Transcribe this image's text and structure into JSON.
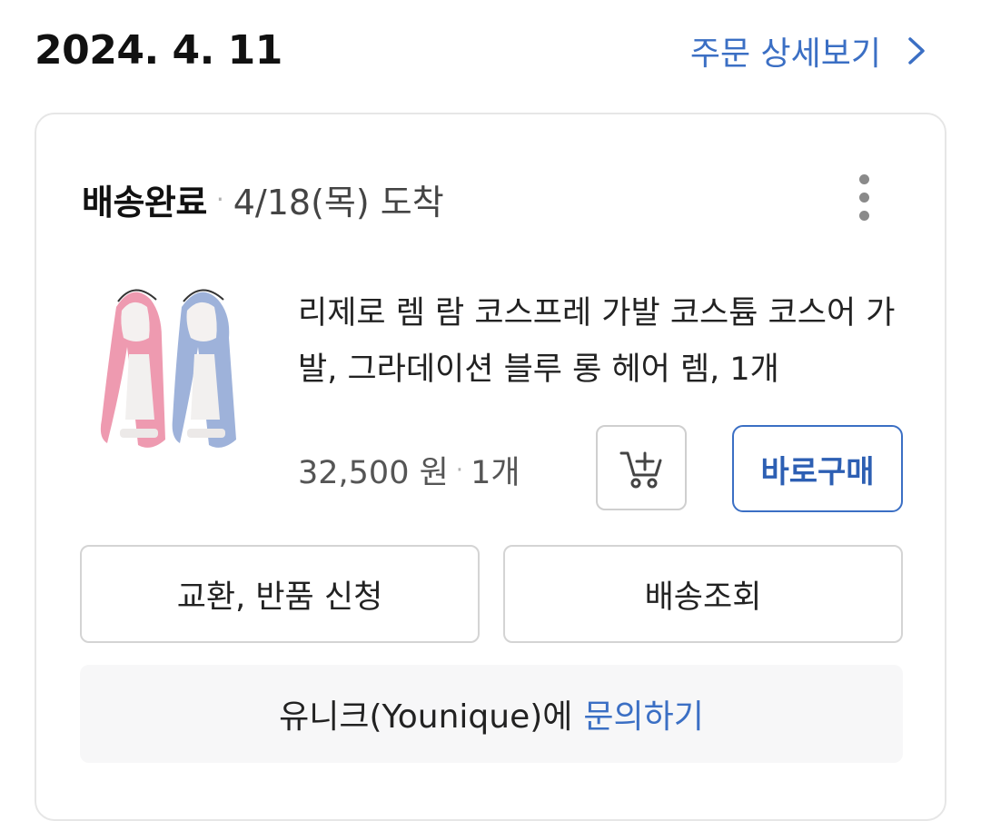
{
  "header": {
    "order_date": "2024. 4. 11",
    "detail_link": "주문 상세보기"
  },
  "card": {
    "status": "배송완료",
    "separator": "·",
    "arrival": "4/18(목) 도착",
    "product": {
      "title": "리제로 렘 람 코스프레 가발 코스튬 코스어 가발, 그라데이션 블루 롱 헤어 렘, 1개",
      "price": "32,500 원",
      "quantity": "1개",
      "thumbnail_icon": "wig-product-image"
    },
    "buy_now_label": "바로구매",
    "cart_icon": "add-to-cart-icon",
    "exchange_return_label": "교환, 반품 신청",
    "track_delivery_label": "배송조회",
    "inquiry": {
      "seller": "유니크(Younique)에",
      "link": "문의하기"
    }
  },
  "colors": {
    "accent": "#3b6fc4",
    "border": "#e6e6e6",
    "inquiry_bg": "#f7f7f8"
  }
}
